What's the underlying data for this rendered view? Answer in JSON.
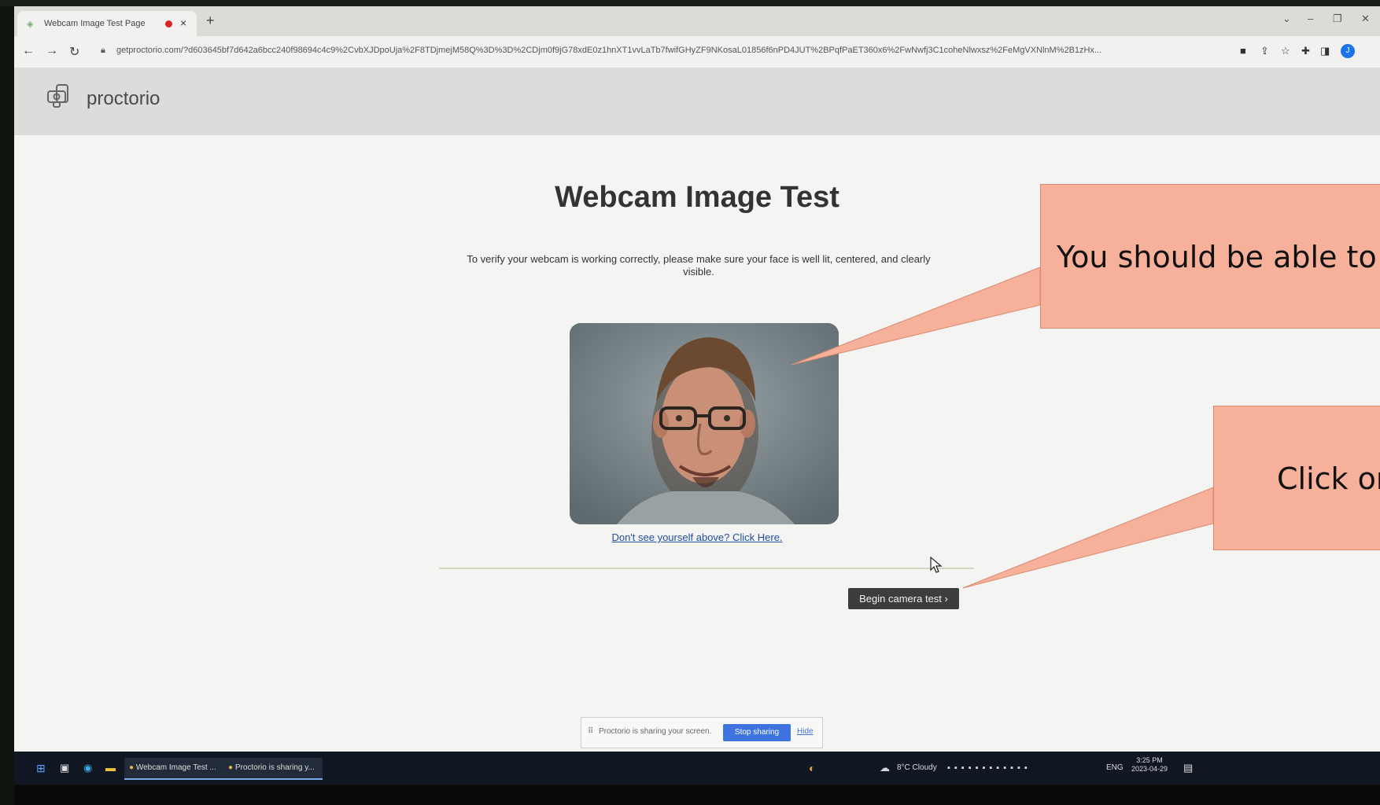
{
  "browser": {
    "tab_title": "Webcam Image Test Page",
    "tab_close": "×",
    "new_tab": "+",
    "url": "getproctorio.com/?d603645bf7d642a6bcc240f98694c4c9%2CvbXJDpoUja%2F8TDjmejM58Q%3D%3D%2CDjm0f9jG78xdE0z1hnXT1vvLaTb7fwifGHyZF9NKosaL01856f6nPD4JUT%2BPqfPaET360x6%2FwNwfj3C1coheNlwxsz%2FeMgVXNlnM%2B1zHx..."
  },
  "site": {
    "logo_text": "proctorio"
  },
  "page": {
    "title": "Webcam Image Test",
    "instruction": "To verify your webcam is working correctly, please make sure your face is well lit, centered, and clearly visible.",
    "help_link": "Don't see yourself above? Click Here.",
    "begin_button": "Begin camera test ›"
  },
  "share_bar": {
    "message": "Proctorio is sharing your screen.",
    "stop_button": "Stop sharing",
    "hide_link": "Hide"
  },
  "taskbar": {
    "app1": "Webcam Image Test ...",
    "app2": "Proctorio is sharing y...",
    "weather": "8°C Cloudy",
    "lang": "ENG",
    "time": "3:25 PM",
    "date": "2023-04-29"
  },
  "callouts": {
    "first": "You should be able to",
    "second": "Click on"
  },
  "colors": {
    "callout_fill": "#f7b09a",
    "begin_button_bg": "#3b3d3f",
    "stop_button_bg": "#3f74e0"
  }
}
